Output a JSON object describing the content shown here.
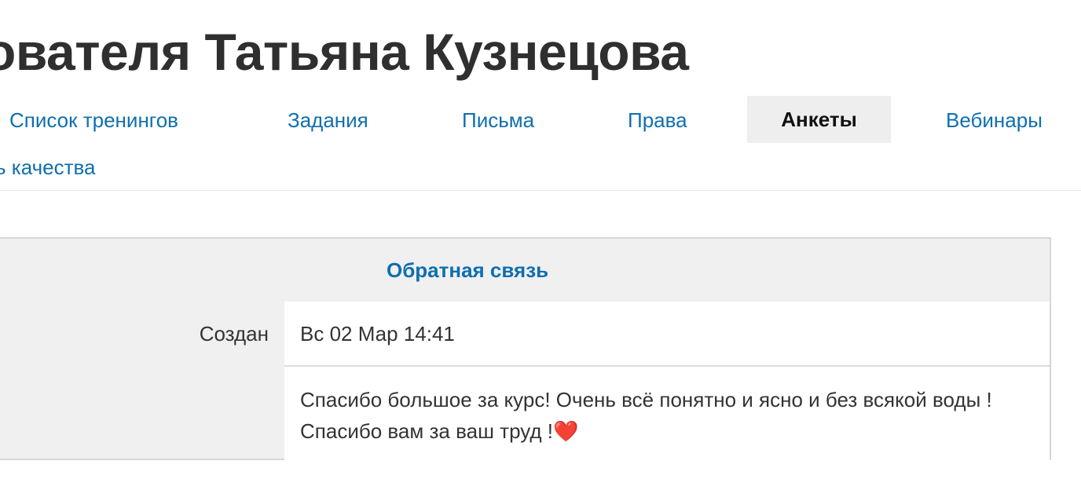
{
  "header": {
    "title": "ователя Татьяна Кузнецова"
  },
  "tabs": [
    {
      "label": "Список тренингов"
    },
    {
      "label": "Задания"
    },
    {
      "label": "Письма"
    },
    {
      "label": "Права"
    },
    {
      "label": "Анкеты",
      "active": true
    },
    {
      "label": "Вебинары"
    },
    {
      "label": "ь качества"
    }
  ],
  "panel": {
    "title": "Обратная связь",
    "rows": [
      {
        "label": "Создан",
        "value": "Вс 02 Мар 14:41"
      },
      {
        "label": "",
        "value": "Спасибо большое за курс! Очень всё понятно и ясно и без всякой воды ! Спасибо вам за ваш труд !",
        "emoji": "❤️"
      }
    ]
  },
  "colors": {
    "link": "#0f6fae",
    "active_tab_bg": "#eeeeee",
    "panel_bg": "#f0f0f0"
  }
}
